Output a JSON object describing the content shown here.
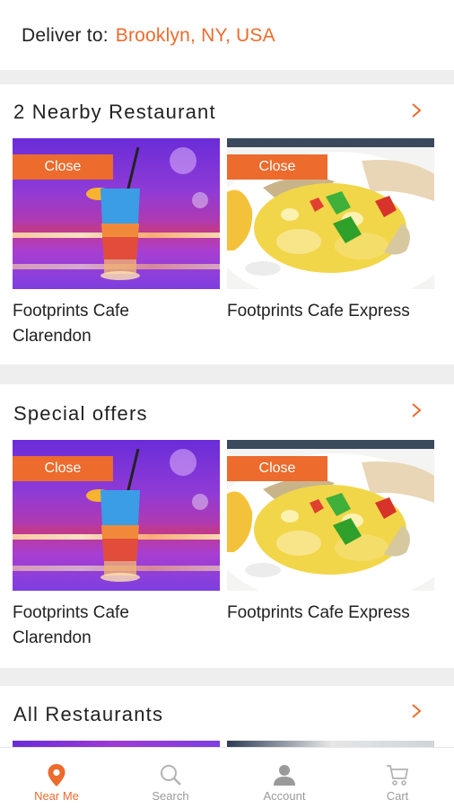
{
  "header": {
    "deliver_label": "Deliver to:",
    "location": "Brooklyn, NY, USA"
  },
  "sections": {
    "nearby": {
      "title": "2 Nearby Restaurant",
      "cards": [
        {
          "badge": "Close",
          "name_line1": "Footprints Cafe",
          "name_line2": "Clarendon",
          "image": "cocktail-drink"
        },
        {
          "badge": "Close",
          "name_line1": "Footprints Cafe Express",
          "name_line2": "",
          "image": "ackee-saltfish-plate"
        }
      ]
    },
    "special": {
      "title": "Special offers",
      "cards": [
        {
          "badge": "Close",
          "name_line1": "Footprints Cafe",
          "name_line2": "Clarendon",
          "image": "cocktail-drink"
        },
        {
          "badge": "Close",
          "name_line1": "Footprints Cafe Express",
          "name_line2": "",
          "image": "ackee-saltfish-plate"
        }
      ]
    },
    "all": {
      "title": "All Restaurants"
    }
  },
  "nav": {
    "items": [
      {
        "label": "Near Me",
        "icon": "location-pin-icon",
        "active": true
      },
      {
        "label": "Search",
        "icon": "search-icon",
        "active": false
      },
      {
        "label": "Account",
        "icon": "user-icon",
        "active": false
      },
      {
        "label": "Cart",
        "icon": "cart-icon",
        "active": false
      }
    ]
  },
  "colors": {
    "accent": "#ec6b2d",
    "divider": "#eeeeee",
    "inactive": "#9a9a9a"
  }
}
